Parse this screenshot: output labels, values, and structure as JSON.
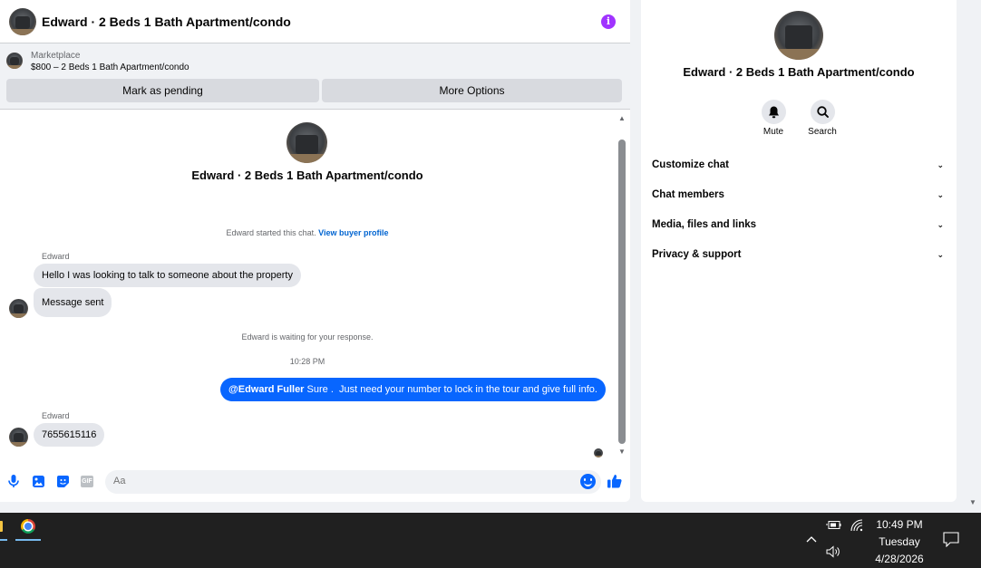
{
  "header": {
    "title": "Edward · 2 Beds 1 Bath Apartment/condo",
    "info_icon": "info-icon"
  },
  "marketplace": {
    "label": "Marketplace",
    "listing": "$800 – 2 Beds 1 Bath Apartment/condo",
    "buttons": {
      "pending": "Mark as pending",
      "more": "More Options"
    }
  },
  "conversation": {
    "title": "Edward · 2 Beds 1 Bath Apartment/condo",
    "started_text": "Edward started this chat.",
    "view_profile": "View buyer profile",
    "messages": [
      {
        "sender": "Edward",
        "text": "Hello I was looking to talk to someone about the property"
      },
      {
        "text": "Message sent"
      }
    ],
    "waiting_text": "Edward is waiting for your response.",
    "timestamp": "10:28 PM",
    "outgoing": {
      "mention": "@Edward Fuller",
      "text": " Sure .  Just need your number to lock in the tour and give full info."
    },
    "reply": {
      "sender": "Edward",
      "text": "7655615116"
    }
  },
  "composer": {
    "placeholder": "Aa",
    "icons": [
      "microphone-icon",
      "image-icon",
      "sticker-icon",
      "gif-icon",
      "emoji-icon",
      "like-icon"
    ],
    "gif_label": "GIF"
  },
  "side_panel": {
    "title": "Edward · 2 Beds 1 Bath Apartment/condo",
    "actions": {
      "mute": "Mute",
      "search": "Search"
    },
    "sections": [
      "Customize chat",
      "Chat members",
      "Media, files and links",
      "Privacy & support"
    ]
  },
  "taskbar": {
    "time": "10:49 PM",
    "day": "Tuesday",
    "date": "4/28/2026"
  },
  "colors": {
    "accent": "#0866ff",
    "info": "#a033ff",
    "taskbar": "#202020"
  }
}
